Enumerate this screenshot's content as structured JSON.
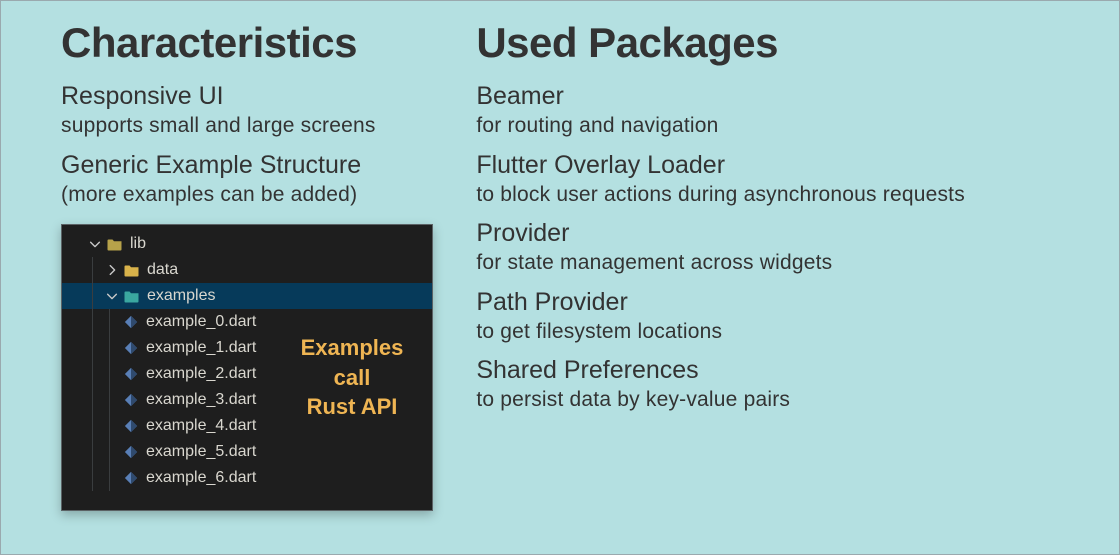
{
  "left": {
    "heading": "Characteristics",
    "items": [
      {
        "title": "Responsive UI",
        "sub": "supports small and large screens"
      },
      {
        "title": "Generic Example Structure",
        "sub": "(more examples can be added)"
      }
    ],
    "tree": {
      "lib": {
        "label": "lib",
        "expanded": true
      },
      "data": {
        "label": "data",
        "expanded": false
      },
      "examples": {
        "label": "examples",
        "expanded": true
      },
      "files": [
        "example_0.dart",
        "example_1.dart",
        "example_2.dart",
        "example_3.dart",
        "example_4.dart",
        "example_5.dart",
        "example_6.dart"
      ],
      "callout_l1": "Examples",
      "callout_l2": "call",
      "callout_l3": "Rust API"
    }
  },
  "right": {
    "heading": "Used Packages",
    "items": [
      {
        "title": "Beamer",
        "sub": "for routing and navigation"
      },
      {
        "title": "Flutter Overlay Loader",
        "sub": "to block user actions during asynchronous requests"
      },
      {
        "title": "Provider",
        "sub": "for state management across widgets"
      },
      {
        "title": "Path Provider",
        "sub": "to get filesystem locations"
      },
      {
        "title": "Shared Preferences",
        "sub": "to persist data by key-value pairs"
      }
    ]
  }
}
